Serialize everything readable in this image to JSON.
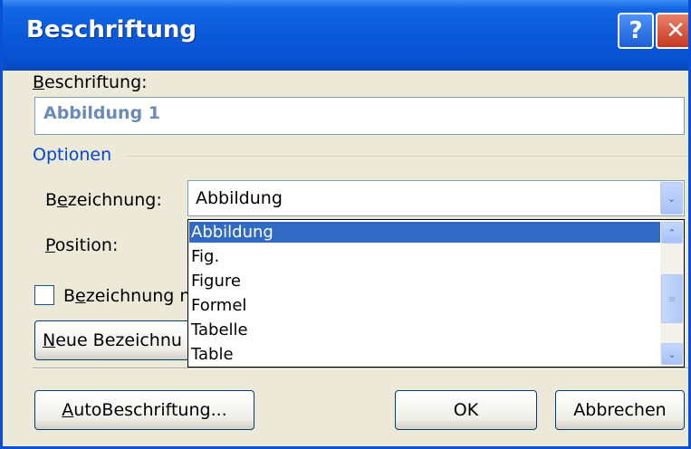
{
  "window": {
    "title": "Beschriftung",
    "help_glyph": "?",
    "close_glyph": "✕"
  },
  "caption": {
    "label_accel": "B",
    "label_rest": "eschriftung:",
    "value": "Abbildung 1"
  },
  "options": {
    "group_label": "Optionen",
    "label_field": {
      "label_pre": "B",
      "label_accel": "e",
      "label_rest": "zeichnung:",
      "value": "Abbildung",
      "arrow_glyph": "⌄"
    },
    "position_field": {
      "label_accel": "P",
      "label_rest": "osition:"
    },
    "dropdown": {
      "items": [
        "Abbildung",
        "Fig.",
        "Figure",
        "Formel",
        "Tabelle",
        "Table"
      ],
      "selected_index": 0,
      "scroll_up_glyph": "⌃",
      "scroll_down_glyph": "⌄",
      "thumb_glyph": "≡"
    },
    "exclude_label_checkbox": {
      "label_pre": "B",
      "label_accel": "e",
      "label_rest": "zeichnung n",
      "checked": false
    },
    "new_label_button": {
      "label_accel": "N",
      "label_rest": "eue Bezeichnu"
    }
  },
  "footer": {
    "autocaption": {
      "label_accel": "A",
      "label_rest": "utoBeschriftung..."
    },
    "ok": "OK",
    "cancel": "Abbrechen"
  }
}
